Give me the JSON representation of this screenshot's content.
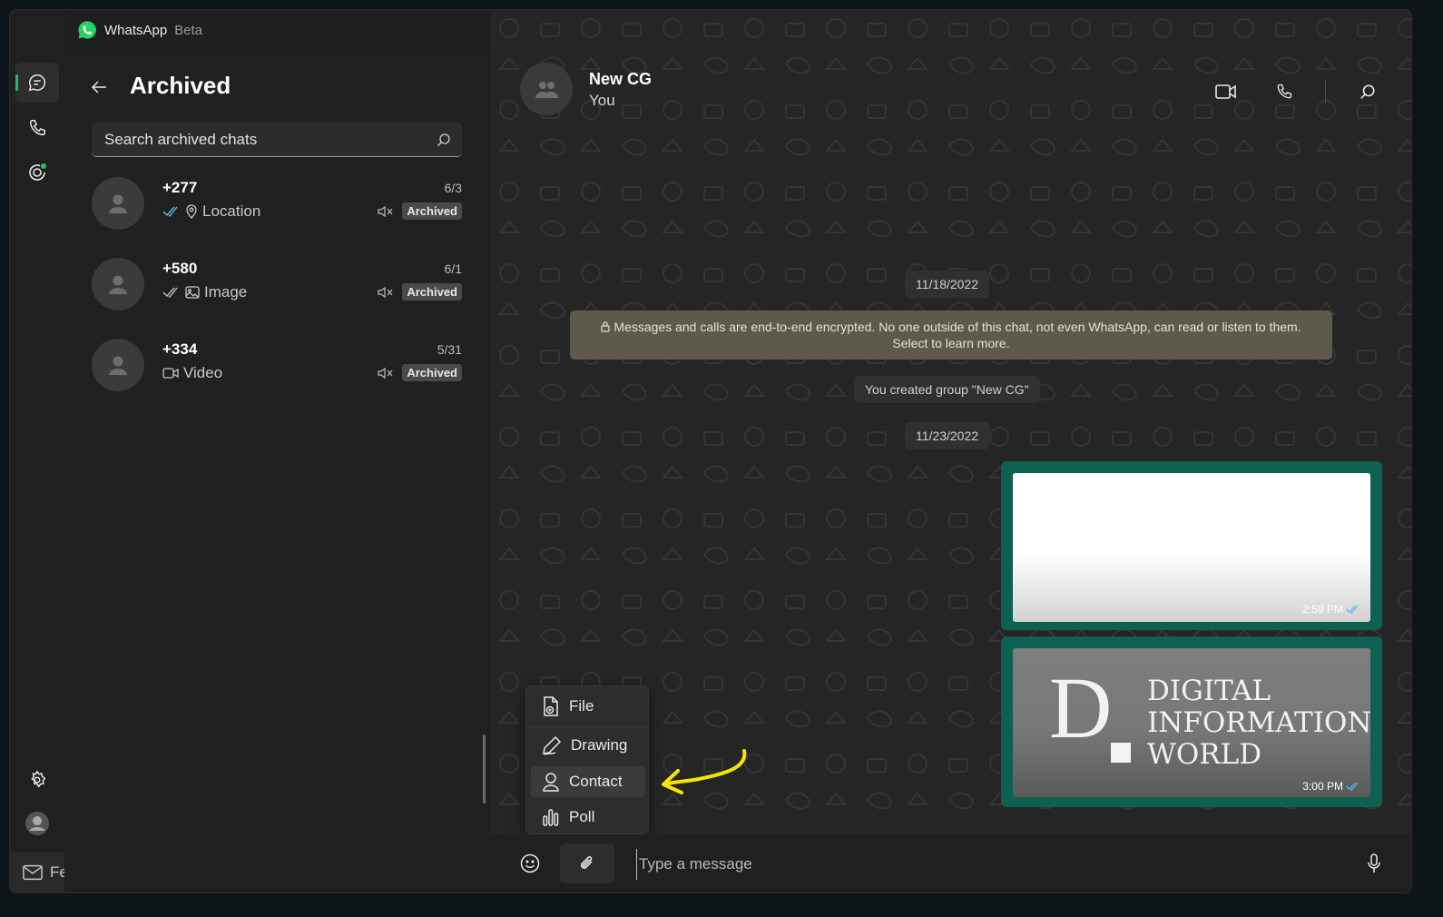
{
  "app": {
    "name": "WhatsApp",
    "tag": "Beta"
  },
  "sidebar": {
    "title": "Archived",
    "search_placeholder": "Search archived chats",
    "feedback_label": "Feedback",
    "chats": [
      {
        "name": "+277",
        "date": "6/3",
        "preview": "Location",
        "badge": "Archived"
      },
      {
        "name": "+580",
        "date": "6/1",
        "preview": "Image",
        "badge": "Archived"
      },
      {
        "name": "+334",
        "date": "5/31",
        "preview": "Video",
        "badge": "Archived"
      }
    ]
  },
  "chat": {
    "name": "New CG",
    "subtitle": "You",
    "date1": "11/18/2022",
    "encryption_notice_line1": "Messages and calls are end-to-end encrypted. No one outside of this chat, not even WhatsApp, can read or listen to them.",
    "encryption_notice_line2": "Select to learn more.",
    "system_message": "You created group \"New CG\"",
    "date2": "11/23/2022",
    "messages": [
      {
        "time": "2:59 PM"
      },
      {
        "time": "3:00 PM",
        "image_text": {
          "letter": "D",
          "line1": "DIGITAL",
          "line2": "INFORMATION",
          "line3": "WORLD"
        }
      }
    ]
  },
  "attach_menu": {
    "items": [
      "File",
      "Drawing",
      "Contact",
      "Poll"
    ],
    "highlighted": "Contact"
  },
  "composer": {
    "placeholder": "Type a message"
  },
  "colors": {
    "accent": "#21c063",
    "outgoing_bubble": "#0e6151",
    "annotation": "#f5e600",
    "read_tick": "#53bdeb"
  }
}
